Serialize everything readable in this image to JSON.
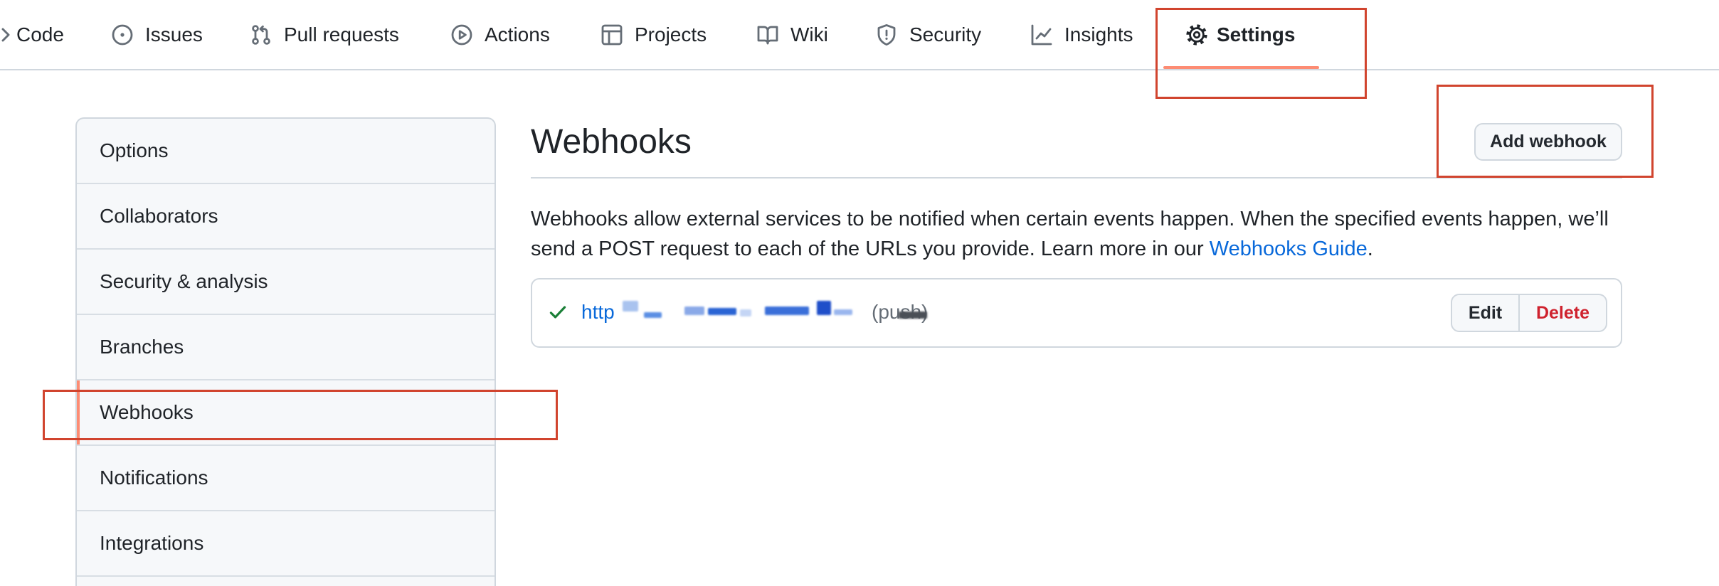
{
  "nav": {
    "items": [
      {
        "label": "Code",
        "icon": "code-icon"
      },
      {
        "label": "Issues",
        "icon": "issue-opened-icon"
      },
      {
        "label": "Pull requests",
        "icon": "git-pull-request-icon"
      },
      {
        "label": "Actions",
        "icon": "play-icon"
      },
      {
        "label": "Projects",
        "icon": "table-icon"
      },
      {
        "label": "Wiki",
        "icon": "book-icon"
      },
      {
        "label": "Security",
        "icon": "shield-icon"
      },
      {
        "label": "Insights",
        "icon": "graph-icon"
      },
      {
        "label": "Settings",
        "icon": "gear-icon",
        "selected": true
      }
    ]
  },
  "sidebar": {
    "items": [
      {
        "label": "Options"
      },
      {
        "label": "Collaborators"
      },
      {
        "label": "Security & analysis"
      },
      {
        "label": "Branches"
      },
      {
        "label": "Webhooks",
        "selected": true
      },
      {
        "label": "Notifications"
      },
      {
        "label": "Integrations"
      }
    ]
  },
  "main": {
    "title": "Webhooks",
    "add_button_label": "Add webhook",
    "description": {
      "text": "Webhooks allow external services to be notified when certain events happen. When the specified events happen, we’ll send a POST request to each of the URLs you provide. Learn more in our ",
      "link_text": "Webhooks Guide",
      "suffix": "."
    },
    "webhooks": [
      {
        "status_icon": "check-icon",
        "url": "http",
        "url_redacted": true,
        "events": "(push)",
        "edit_label": "Edit",
        "delete_label": "Delete"
      }
    ]
  },
  "colors": {
    "text": "#1f2328",
    "muted": "#656d76",
    "border": "#d0d7de",
    "canvas_subtle": "#f6f8fa",
    "link": "#0969da",
    "danger": "#cf222e",
    "success": "#1a7f37",
    "selected_underline": "#fd8c73",
    "annotation": "#d1442e"
  }
}
